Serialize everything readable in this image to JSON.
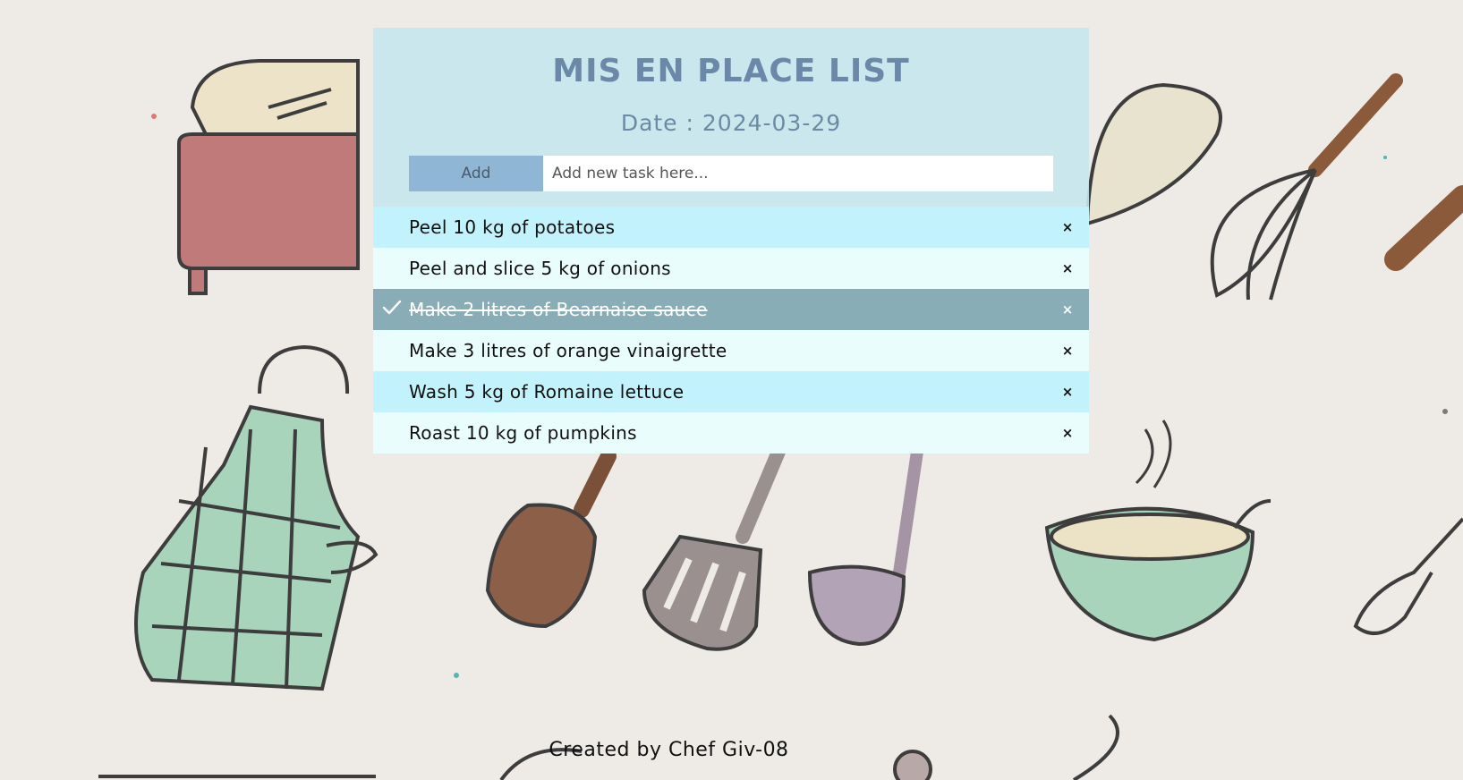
{
  "app": {
    "title": "MIS EN PLACE LIST",
    "date_label": "Date : 2024-03-29"
  },
  "add_form": {
    "button_label": "Add",
    "placeholder": "Add new task here...",
    "value": ""
  },
  "tasks": [
    {
      "text": "Peel 10 kg of potatoes",
      "done": false
    },
    {
      "text": "Peel and slice 5 kg of onions",
      "done": false
    },
    {
      "text": "Make 2 litres of Bearnaise sauce",
      "done": true
    },
    {
      "text": "Make 3 litres of orange vinaigrette",
      "done": false
    },
    {
      "text": "Wash 5 kg of Romaine lettuce",
      "done": false
    },
    {
      "text": "Roast 10 kg of pumpkins",
      "done": false
    }
  ],
  "close_glyph": "×",
  "footer": {
    "credit": "Created by Chef Giv-08"
  },
  "colors": {
    "header_bg": "#c4e7ec",
    "title": "#6b88a8",
    "row_cyan": "#c2f3fc",
    "row_pale": "#e9fdfc",
    "row_done": "#88adb6",
    "add_button": "#8fb6d5"
  },
  "icons": {
    "check": "check-icon",
    "close": "close-icon"
  }
}
